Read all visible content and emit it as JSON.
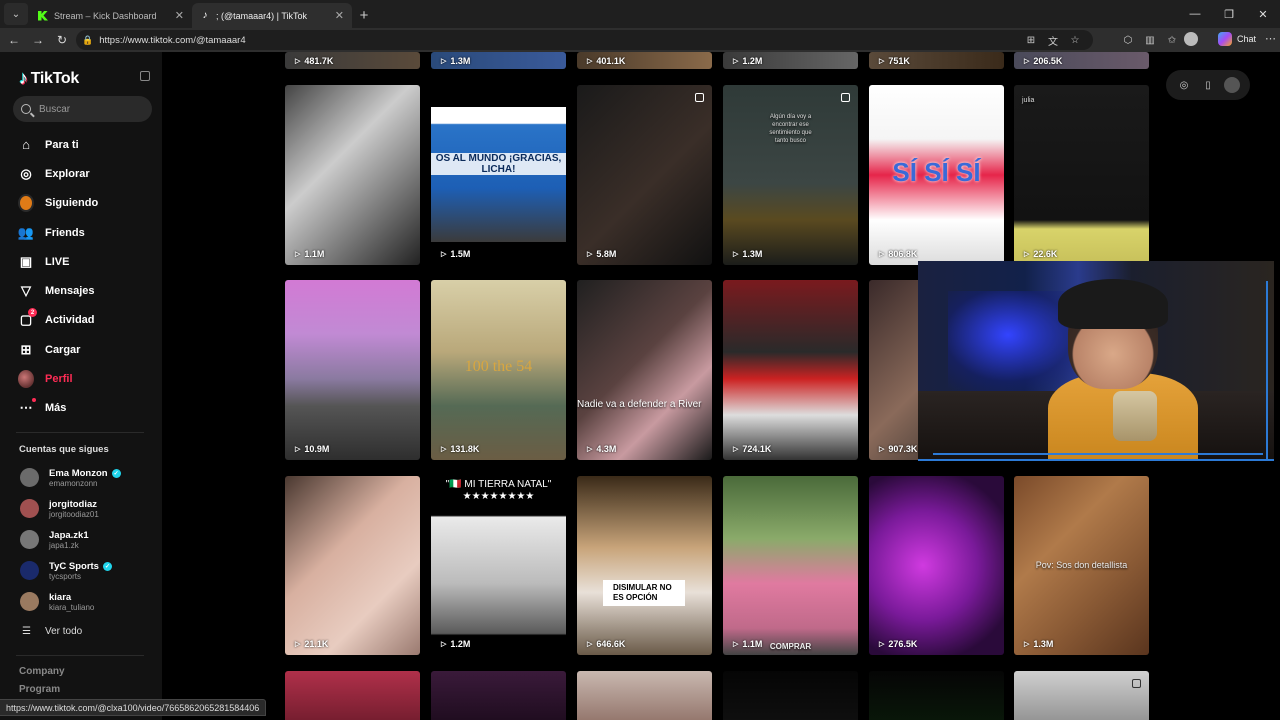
{
  "browser": {
    "tabs": [
      {
        "title": "Stream – Kick Dashboard",
        "favicon": "kick-icon"
      },
      {
        "title": "; (@tamaaar4) | TikTok",
        "favicon": "tiktok-icon"
      }
    ],
    "url": "https://www.tiktok.com/@tamaaar4",
    "copilot_label": "Chat"
  },
  "sidebar": {
    "logo_text": "TikTok",
    "search_placeholder": "Buscar",
    "menu": [
      {
        "label": "Para ti",
        "icon": "home-icon"
      },
      {
        "label": "Explorar",
        "icon": "compass-icon"
      },
      {
        "label": "Siguiendo",
        "icon": "following-avatar-icon"
      },
      {
        "label": "Friends",
        "icon": "friends-icon"
      },
      {
        "label": "LIVE",
        "icon": "live-icon"
      },
      {
        "label": "Mensajes",
        "icon": "send-icon"
      },
      {
        "label": "Actividad",
        "icon": "activity-icon",
        "badge": "2"
      },
      {
        "label": "Cargar",
        "icon": "upload-icon"
      },
      {
        "label": "Perfil",
        "icon": "profile-avatar-icon"
      },
      {
        "label": "Más",
        "icon": "more-icon"
      }
    ],
    "following_title": "Cuentas que sigues",
    "following": [
      {
        "name": "Ema Monzon",
        "handle": "emamonzonn",
        "verified": true,
        "color": "#6b6b6b"
      },
      {
        "name": "jorgitodiaz",
        "handle": "jorgitoodiaz01",
        "verified": false,
        "color": "#a05050"
      },
      {
        "name": "Japa.zk1",
        "handle": "japa1.zk",
        "verified": false,
        "color": "#777777"
      },
      {
        "name": "TyC Sports",
        "handle": "tycsports",
        "verified": true,
        "color": "#1a2a6b"
      },
      {
        "name": "kiara",
        "handle": "kiara_tuliano",
        "verified": false,
        "color": "#9a7a60"
      }
    ],
    "see_all": "Ver todo",
    "footer": [
      "Company",
      "Program"
    ]
  },
  "grid": {
    "top_row_views": [
      "481.7K",
      "1.3M",
      "401.1K",
      "1.2M",
      "751K",
      "206.5K"
    ],
    "row1": [
      {
        "views": "1.1M",
        "bg": "linear-gradient(135deg,#444,#ccc 40%,#777 70%,#222)",
        "caption": ""
      },
      {
        "views": "1.5M",
        "bg": "linear-gradient(180deg,#fff 0%,#fff 12%,#2a74c8 13%,#1d5fb5 60%,#3b3b3b 100%)",
        "caption": "OS AL MUNDO ¡GRACIAS, LICHA!"
      },
      {
        "views": "5.8M",
        "bg": "linear-gradient(135deg,#1a1a1a,#3a2e28 55%,#111)",
        "caption": ""
      },
      {
        "views": "1.3M",
        "bg": "linear-gradient(180deg,#2f3a38 0%,#3c4644 55%,#5a4a20 75%,#1b1d1a 100%)",
        "caption": "Algún día voy a encontrar ese sentimiento que tanto busco"
      },
      {
        "views": "806.8K",
        "bg": "linear-gradient(180deg,#fff 0%,#f5f5f5 30%,#e6254a 50%,#fff 75%,#dcdcdc 100%)",
        "caption": "SÍ SÍ SÍ"
      },
      {
        "views": "22.6K",
        "bg": "linear-gradient(180deg,#1a1a1a,#121212 75%,#d8d36a 80%,#c7c05a 100%)",
        "caption": "julia"
      }
    ],
    "row2": [
      {
        "views": "10.9M",
        "bg": "linear-gradient(180deg,#d27ad4 0%,#c18ad4 30%,#8a7aa0 55%,#555 70%,#2e2e2e 100%)",
        "caption": ""
      },
      {
        "views": "131.8K",
        "bg": "linear-gradient(180deg,#d8cfa8 0%,#b9a87a 40%,#556a55 70%,#6b5d44 100%)",
        "caption": "100 the 54"
      },
      {
        "views": "4.3M",
        "bg": "linear-gradient(135deg,#202020,#5a4240 45%,#c89aa0 70%,#1a1a1a)",
        "caption": "Nadie va a defender a River"
      },
      {
        "views": "724.1K",
        "bg": "linear-gradient(180deg,#7a1a1e,#2a2a2a 40%,#c22 55%,#ddd 75%,#333 100%)",
        "caption": ""
      },
      {
        "views": "907.3K",
        "bg": "linear-gradient(135deg,#3a2a2a,#8a6a5a 50%,#222)",
        "caption": ""
      }
    ],
    "row3": [
      {
        "views": "21.1K",
        "bg": "linear-gradient(135deg,#4a3830,#d8b0a0 40%,#e8ccc0 70%,#9a7a70)",
        "caption": ""
      },
      {
        "views": "1.2M",
        "bg": "linear-gradient(180deg,#000 0%,#000 22%,#eaeaea 23%,#bbb 60%,#5a5a5a 88%,#000 89%)",
        "caption": "\"🇮🇹 MI TIERRA NATAL\" ★★★★★★★★"
      },
      {
        "views": "646.6K",
        "bg": "linear-gradient(180deg,#3a2a18,#c8a47a 40%,#e8e0d8 65%,#6a5a48 100%)",
        "caption": "DISIMULAR NO ES OPCIÓN"
      },
      {
        "views": "1.1M",
        "bg": "linear-gradient(180deg,#4a6a3a,#8aaa6a 35%,#e07aa0 60%,#c06a8a 85%,#444 100%)",
        "caption": "COMPRAR"
      },
      {
        "views": "276.5K",
        "bg": "radial-gradient(circle at 40% 50%,#d03ae0 0%,#7a1a9a 45%,#2a0a3a 80%)",
        "caption": ""
      },
      {
        "views": "1.3M",
        "bg": "linear-gradient(135deg,#7a4a2a,#b07a4a 35%,#8a5a35 65%,#5a351e)",
        "caption": "Pov: Sos don detallista"
      }
    ],
    "row4_bgs": [
      "linear-gradient(180deg,#b0304a,#6a1a2a)",
      "linear-gradient(180deg,#3a1a3a,#1a0a1a)",
      "linear-gradient(180deg,#c9b8b0,#8a6a60)",
      "linear-gradient(180deg,#050505,#111)",
      "linear-gradient(180deg,#050505,#0a1a0a)",
      "linear-gradient(180deg,#d0d0d0,#888)"
    ]
  },
  "status_url": "https://www.tiktok.com/@clxa100/video/7665862065281584406"
}
